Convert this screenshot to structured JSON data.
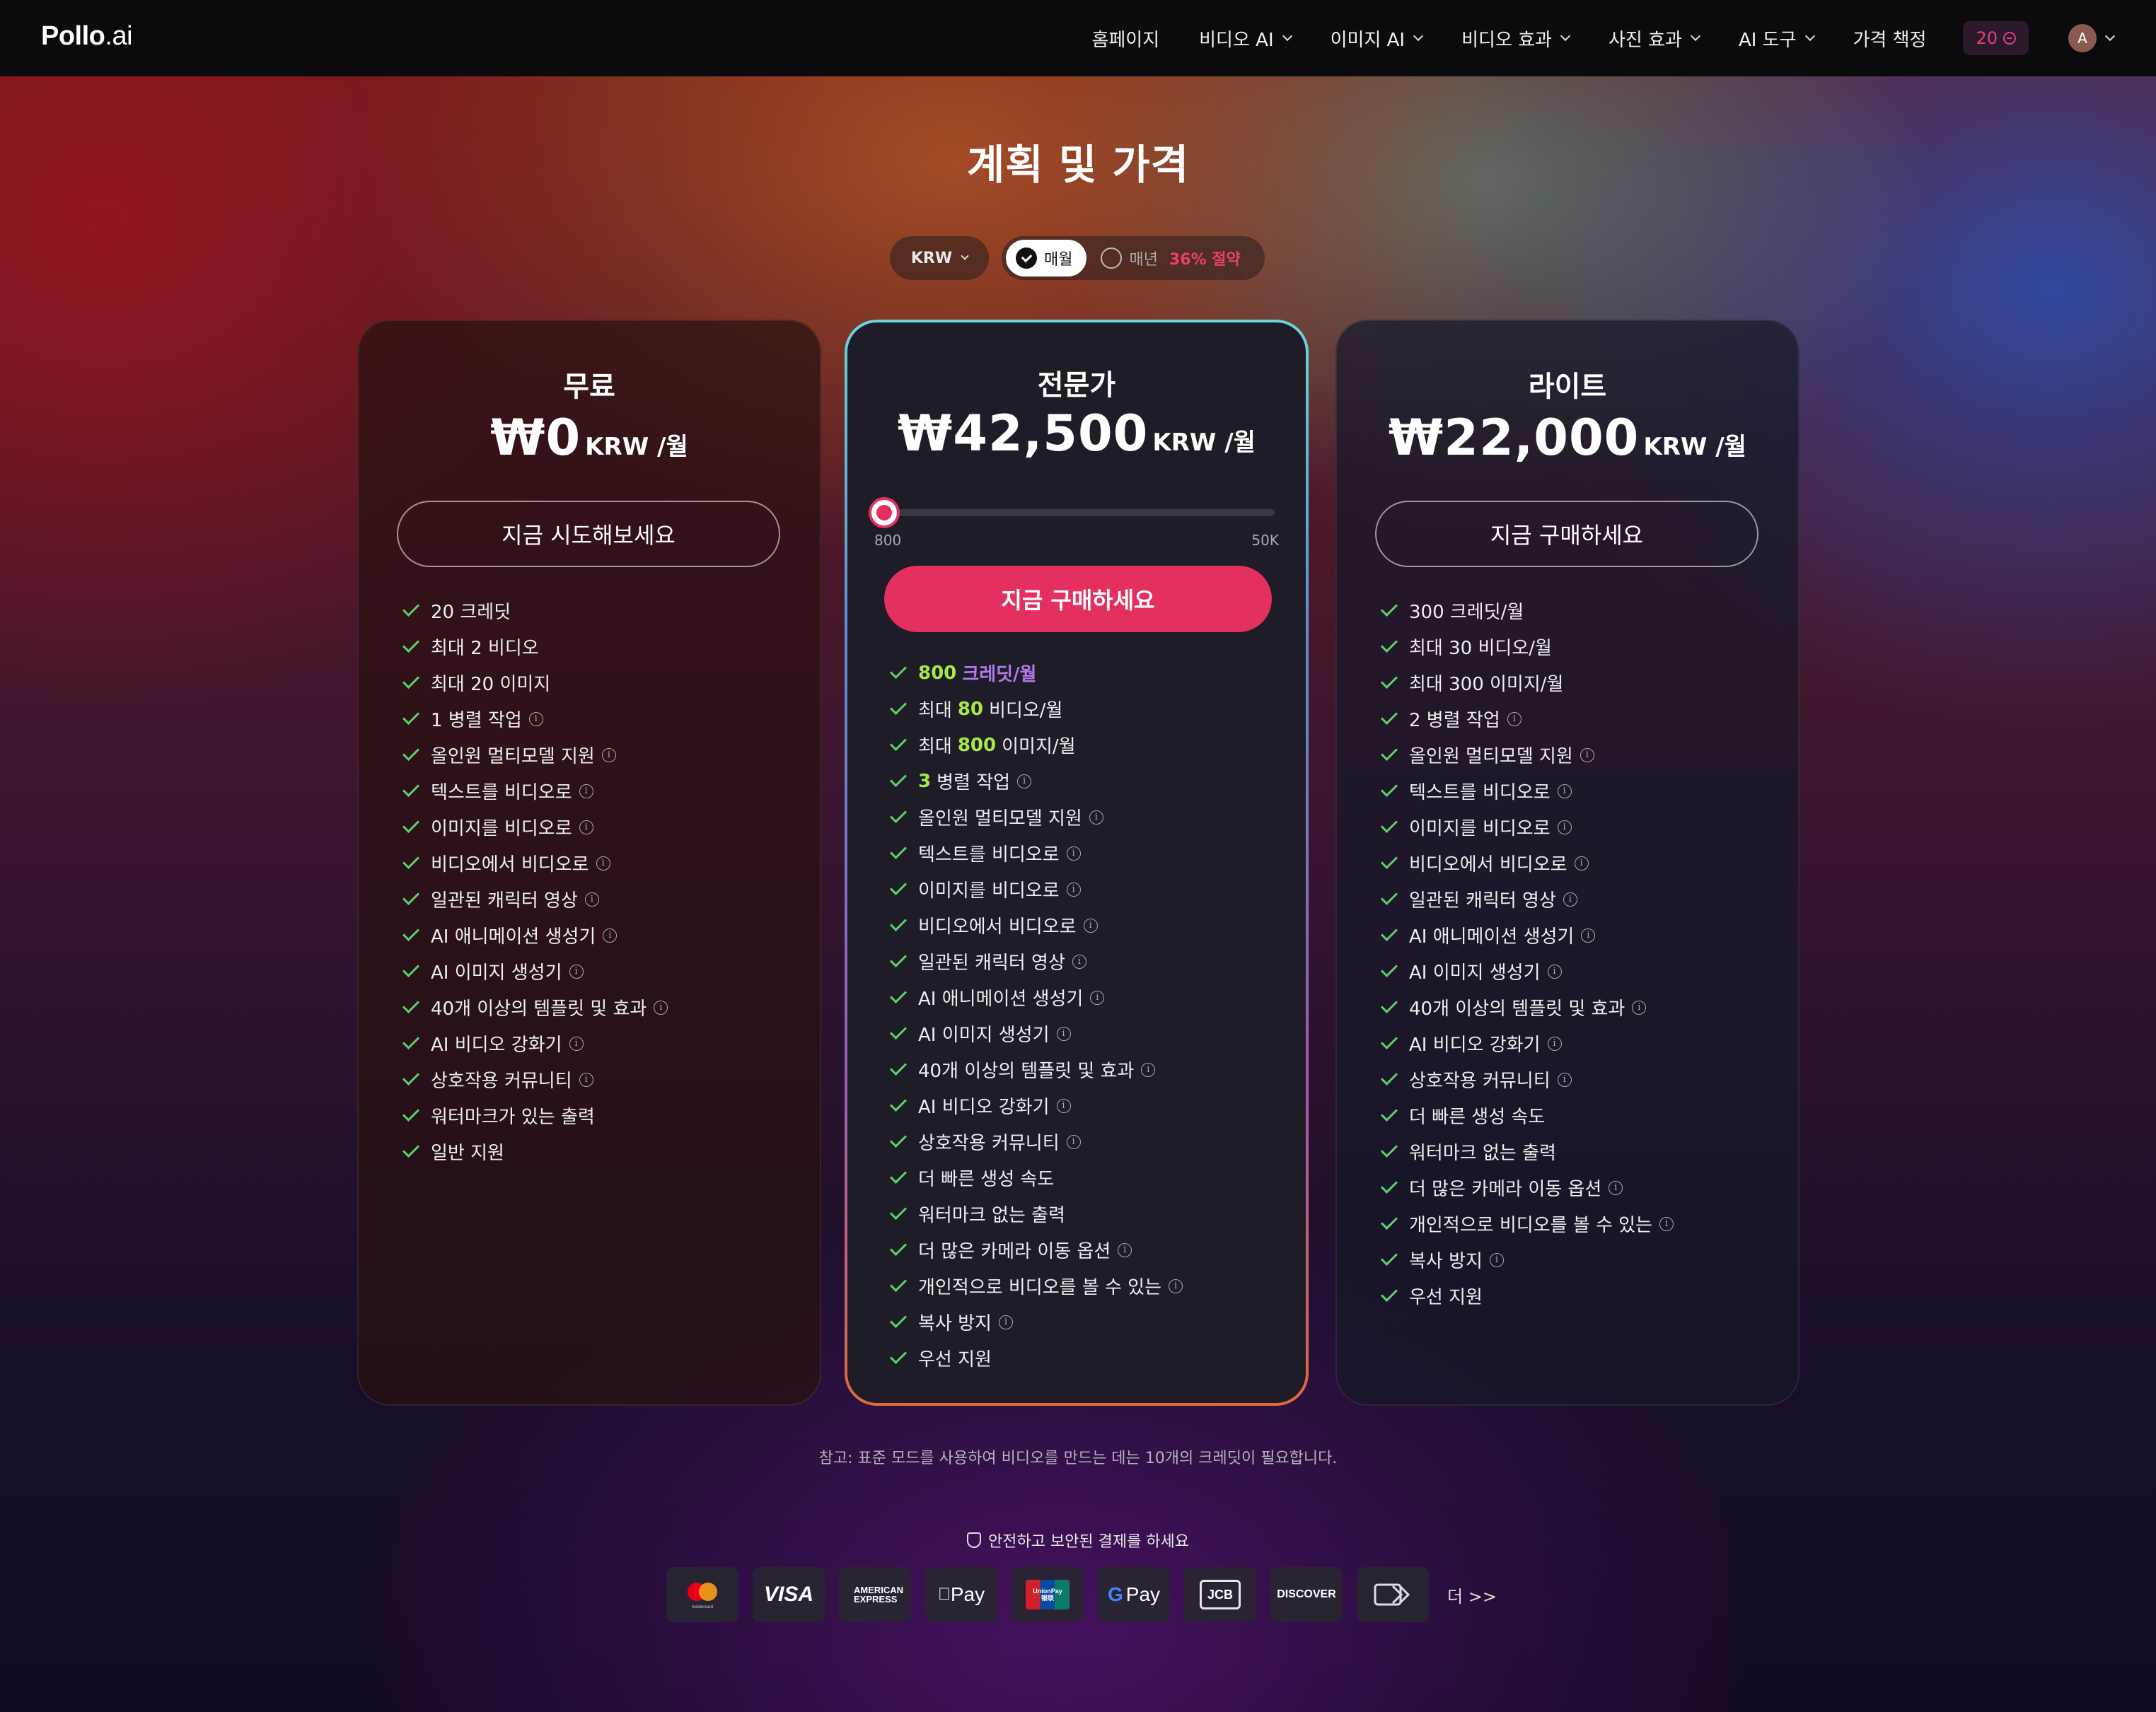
{
  "nav": {
    "logo_main": "Pollo",
    "logo_suffix": ".ai",
    "items": [
      {
        "label": "홈페이지"
      },
      {
        "label": "비디오 AI"
      },
      {
        "label": "이미지 AI"
      },
      {
        "label": "비디오 효과"
      },
      {
        "label": "사진 효과"
      },
      {
        "label": "AI 도구"
      },
      {
        "label": "가격 책정"
      }
    ],
    "credits": "20",
    "avatar_letter": "A"
  },
  "title": "계획 및 가격",
  "controls": {
    "currency": "KRW",
    "monthly": "매월",
    "yearly": "매년",
    "save": "36% 절약"
  },
  "plans": {
    "free": {
      "name": "무료",
      "price": "₩0",
      "unit": "KRW /월",
      "cta": "지금 시도해보세요",
      "features": [
        {
          "text": "20 크레딧",
          "info": false
        },
        {
          "text": "최대 2 비디오",
          "info": false
        },
        {
          "text": "최대 20 이미지",
          "info": false
        },
        {
          "text": "1 병렬 작업",
          "info": true
        },
        {
          "text": "올인원 멀티모델 지원",
          "info": true
        },
        {
          "text": "텍스트를 비디오로",
          "info": true
        },
        {
          "text": "이미지를 비디오로",
          "info": true
        },
        {
          "text": "비디오에서 비디오로",
          "info": true
        },
        {
          "text": "일관된 캐릭터 영상",
          "info": true
        },
        {
          "text": "AI 애니메이션 생성기",
          "info": true
        },
        {
          "text": "AI 이미지 생성기",
          "info": true
        },
        {
          "text": "40개 이상의 템플릿 및 효과",
          "info": true
        },
        {
          "text": "AI 비디오 강화기",
          "info": true
        },
        {
          "text": "상호작용 커뮤니티",
          "info": true
        },
        {
          "text": "워터마크가 있는 출력",
          "info": false
        },
        {
          "text": "일반 지원",
          "info": false
        }
      ]
    },
    "pro": {
      "name": "전문가",
      "price": "₩42,500",
      "unit": "KRW /월",
      "slider_min": "800",
      "slider_max": "50K",
      "slider_value": 0,
      "cta": "지금 구매하세요",
      "credits_hl": "800",
      "credits_suffix": "크레딧/월",
      "videos_prefix": "최대",
      "videos_hl": "80",
      "videos_suffix": "비디오/월",
      "images_prefix": "최대",
      "images_hl": "800",
      "images_suffix": "이미지/월",
      "parallel_hl": "3",
      "parallel_suffix": "병렬 작업",
      "features": [
        {
          "text": "올인원 멀티모델 지원",
          "info": true
        },
        {
          "text": "텍스트를 비디오로",
          "info": true
        },
        {
          "text": "이미지를 비디오로",
          "info": true
        },
        {
          "text": "비디오에서 비디오로",
          "info": true
        },
        {
          "text": "일관된 캐릭터 영상",
          "info": true
        },
        {
          "text": "AI 애니메이션 생성기",
          "info": true
        },
        {
          "text": "AI 이미지 생성기",
          "info": true
        },
        {
          "text": "40개 이상의 템플릿 및 효과",
          "info": true
        },
        {
          "text": "AI 비디오 강화기",
          "info": true
        },
        {
          "text": "상호작용 커뮤니티",
          "info": true
        },
        {
          "text": "더 빠른 생성 속도",
          "info": false
        },
        {
          "text": "워터마크 없는 출력",
          "info": false
        },
        {
          "text": "더 많은 카메라 이동 옵션",
          "info": true
        },
        {
          "text": "개인적으로 비디오를 볼 수 있는",
          "info": true
        },
        {
          "text": "복사 방지",
          "info": true
        },
        {
          "text": "우선 지원",
          "info": false
        }
      ]
    },
    "lite": {
      "name": "라이트",
      "price": "₩22,000",
      "unit": "KRW /월",
      "cta": "지금 구매하세요",
      "features": [
        {
          "text": "300 크레딧/월",
          "info": false
        },
        {
          "text": "최대 30 비디오/월",
          "info": false
        },
        {
          "text": "최대 300 이미지/월",
          "info": false
        },
        {
          "text": "2 병렬 작업",
          "info": true
        },
        {
          "text": "올인원 멀티모델 지원",
          "info": true
        },
        {
          "text": "텍스트를 비디오로",
          "info": true
        },
        {
          "text": "이미지를 비디오로",
          "info": true
        },
        {
          "text": "비디오에서 비디오로",
          "info": true
        },
        {
          "text": "일관된 캐릭터 영상",
          "info": true
        },
        {
          "text": "AI 애니메이션 생성기",
          "info": true
        },
        {
          "text": "AI 이미지 생성기",
          "info": true
        },
        {
          "text": "40개 이상의 템플릿 및 효과",
          "info": true
        },
        {
          "text": "AI 비디오 강화기",
          "info": true
        },
        {
          "text": "상호작용 커뮤니티",
          "info": true
        },
        {
          "text": "더 빠른 생성 속도",
          "info": false
        },
        {
          "text": "워터마크 없는 출력",
          "info": false
        },
        {
          "text": "더 많은 카메라 이동 옵션",
          "info": true
        },
        {
          "text": "개인적으로 비디오를 볼 수 있는",
          "info": true
        },
        {
          "text": "복사 방지",
          "info": true
        },
        {
          "text": "우선 지원",
          "info": false
        }
      ]
    }
  },
  "note": "참고: 표준 모드를 사용하여 비디오를 만드는 데는 10개의 크레딧이 필요합니다.",
  "secure_text": "안전하고 보안된 결제를 하세요",
  "payments": [
    {
      "name": "mastercard",
      "label": "mastercard"
    },
    {
      "name": "visa",
      "label": "VISA"
    },
    {
      "name": "american-express",
      "label": "AMERICAN EXPRESS"
    },
    {
      "name": "apple-pay",
      "label": "Pay"
    },
    {
      "name": "unionpay",
      "label": "UnionPay 银联"
    },
    {
      "name": "google-pay",
      "label": "Pay"
    },
    {
      "name": "jcb",
      "label": "JCB"
    },
    {
      "name": "discover",
      "label": "DISCOVER"
    },
    {
      "name": "more-payments",
      "label": ""
    }
  ],
  "more_label": "더 >>",
  "colors": {
    "accent": "#e33060",
    "check": "#5ed06a",
    "highlight": "#a6e84a"
  }
}
